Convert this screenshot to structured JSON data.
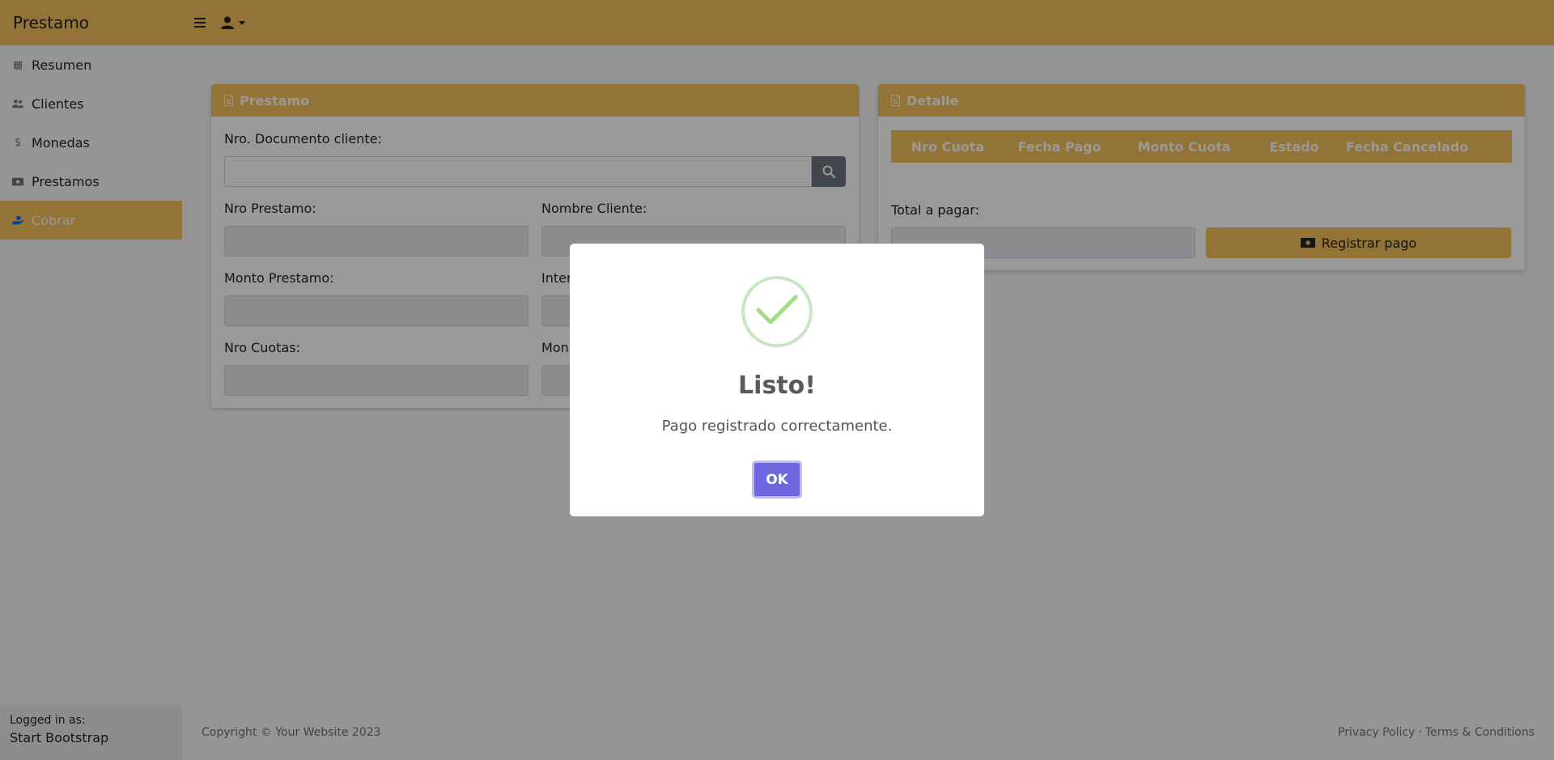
{
  "app": {
    "brand": "Prestamo"
  },
  "sidebar": {
    "items": [
      {
        "label": "Resumen",
        "icon": "table-icon",
        "active": false
      },
      {
        "label": "Clientes",
        "icon": "users-icon",
        "active": false
      },
      {
        "label": "Monedas",
        "icon": "dollar-icon",
        "active": false
      },
      {
        "label": "Prestamos",
        "icon": "money-bill-icon",
        "active": false
      },
      {
        "label": "Cobrar",
        "icon": "hand-holding-dollar-icon",
        "active": true
      }
    ],
    "footer": {
      "logged_in_label": "Logged in as:",
      "user": "Start Bootstrap"
    }
  },
  "prestamo_card": {
    "title": "Prestamo",
    "doc_label": "Nro. Documento cliente:",
    "doc_value": "",
    "nro_prestamo_label": "Nro Prestamo:",
    "nombre_cliente_label": "Nombre Cliente:",
    "monto_prestamo_label": "Monto Prestamo:",
    "interes_label": "Inter",
    "nro_cuotas_label": "Nro Cuotas:",
    "monto_cuota_label": "Mon"
  },
  "detalle_card": {
    "title": "Detalle",
    "columns": [
      "Nro Cuota",
      "Fecha Pago",
      "Monto Cuota",
      "Estado",
      "Fecha Cancelado"
    ],
    "rows": [],
    "total_label": "Total a pagar:",
    "total_value": "",
    "pay_button": "Registrar pago"
  },
  "footer": {
    "copyright": "Copyright © Your Website 2023",
    "privacy": "Privacy Policy",
    "separator": "·",
    "terms": "Terms & Conditions"
  },
  "modal": {
    "title": "Listo!",
    "text": "Pago registrado correctamente.",
    "ok_label": "OK"
  },
  "colors": {
    "accent": "#f6c05a",
    "confirm": "#7066e0",
    "success": "#a5dc86"
  }
}
